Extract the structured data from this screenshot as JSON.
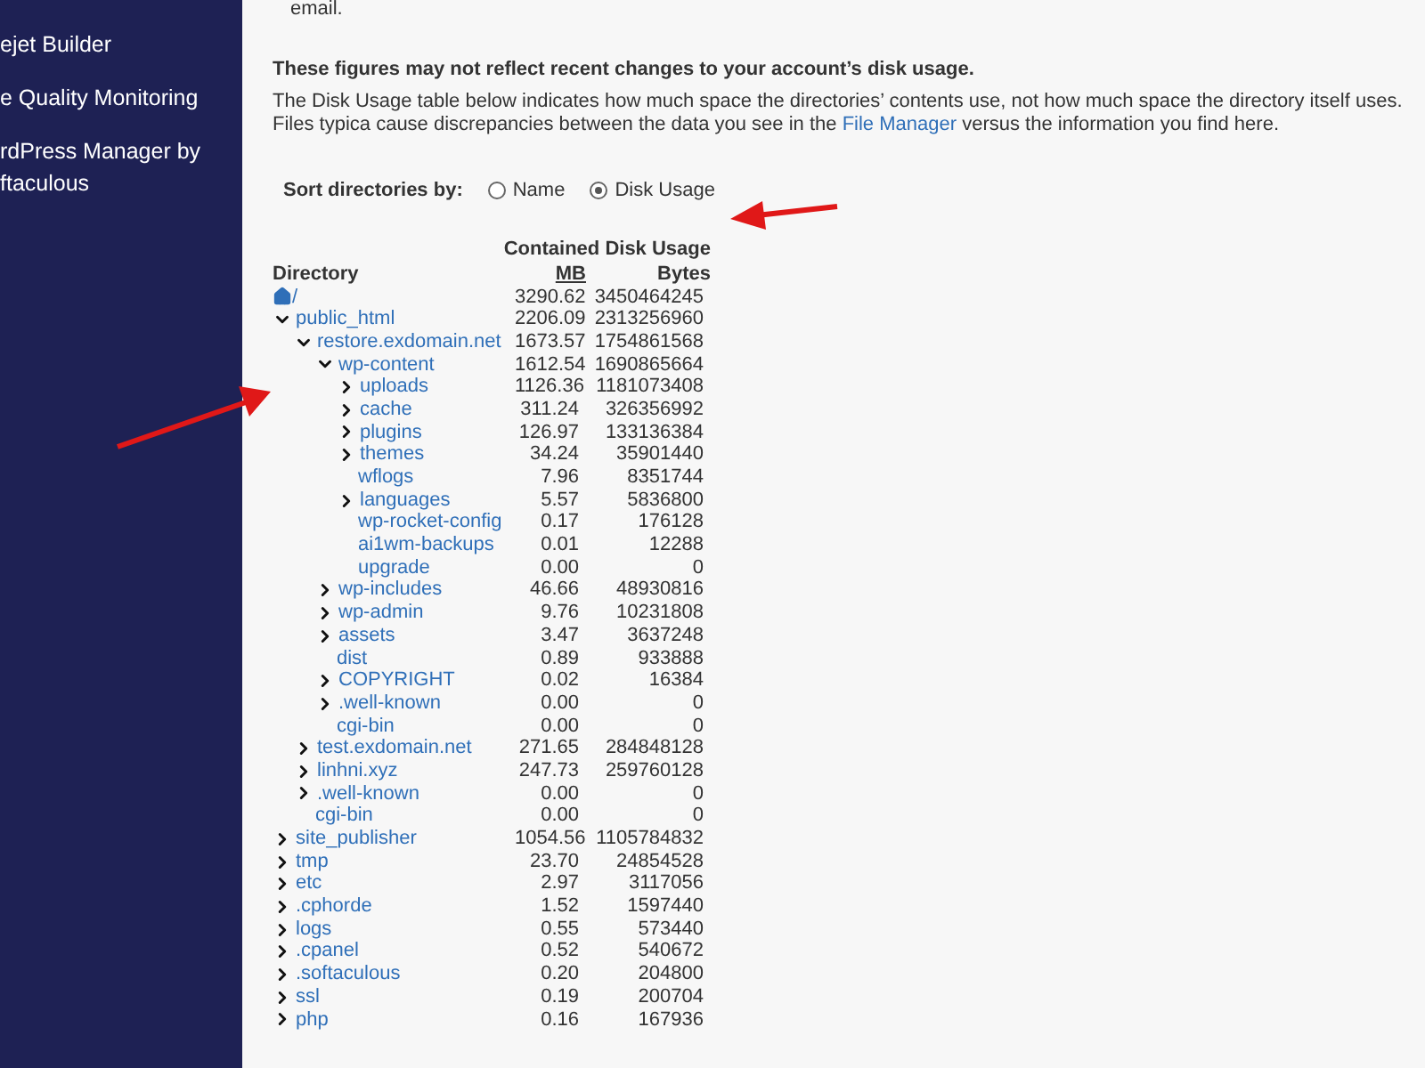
{
  "sidebar": {
    "items": [
      {
        "lines": [
          "ejet Builder"
        ]
      },
      {
        "lines": [
          "e Quality Monitoring"
        ]
      },
      {
        "lines": [
          "rdPress Manager by",
          "ftaculous"
        ]
      }
    ]
  },
  "top_fragment": "email.",
  "notice": {
    "title": "These figures may not reflect recent changes to your account’s disk usage.",
    "text_before": "The Disk Usage table below indicates how much space the directories’ contents use, not how much space the directory itself uses. Files typica cause discrepancies between the data you see in the ",
    "link": "File Manager",
    "text_after": " versus the information you find here."
  },
  "sort": {
    "label": "Sort directories by:",
    "options": [
      {
        "label": "Name",
        "selected": false
      },
      {
        "label": "Disk Usage",
        "selected": true
      }
    ]
  },
  "table": {
    "directory_header": "Directory",
    "group_header": "Contained Disk Usage",
    "mb_header": "MB",
    "bytes_header": "Bytes",
    "rows": [
      {
        "name": "/",
        "kind": "root",
        "mb": "3290.62",
        "bytes": "3450464245"
      },
      {
        "name": "public_html",
        "kind": "branch",
        "expanded": true,
        "mb": "2206.09",
        "bytes": "2313256960",
        "children": [
          {
            "name": "restore.exdomain.net",
            "kind": "branch",
            "expanded": true,
            "mb": "1673.57",
            "bytes": "1754861568",
            "children": [
              {
                "name": "wp-content",
                "kind": "branch",
                "expanded": true,
                "mb": "1612.54",
                "bytes": "1690865664",
                "children": [
                  {
                    "name": "uploads",
                    "kind": "branch",
                    "expanded": false,
                    "mb": "1126.36",
                    "bytes": "1181073408"
                  },
                  {
                    "name": "cache",
                    "kind": "branch",
                    "expanded": false,
                    "mb": "311.24",
                    "bytes": "326356992"
                  },
                  {
                    "name": "plugins",
                    "kind": "branch",
                    "expanded": false,
                    "mb": "126.97",
                    "bytes": "133136384"
                  },
                  {
                    "name": "themes",
                    "kind": "branch",
                    "expanded": false,
                    "mb": "34.24",
                    "bytes": "35901440"
                  },
                  {
                    "name": "wflogs",
                    "kind": "leaf",
                    "mb": "7.96",
                    "bytes": "8351744"
                  },
                  {
                    "name": "languages",
                    "kind": "branch",
                    "expanded": false,
                    "mb": "5.57",
                    "bytes": "5836800"
                  },
                  {
                    "name": "wp-rocket-config",
                    "kind": "leaf",
                    "mb": "0.17",
                    "bytes": "176128"
                  },
                  {
                    "name": "ai1wm-backups",
                    "kind": "leaf",
                    "mb": "0.01",
                    "bytes": "12288"
                  },
                  {
                    "name": "upgrade",
                    "kind": "leaf",
                    "mb": "0.00",
                    "bytes": "0"
                  }
                ]
              },
              {
                "name": "wp-includes",
                "kind": "branch",
                "expanded": false,
                "mb": "46.66",
                "bytes": "48930816"
              },
              {
                "name": "wp-admin",
                "kind": "branch",
                "expanded": false,
                "mb": "9.76",
                "bytes": "10231808"
              },
              {
                "name": "assets",
                "kind": "branch",
                "expanded": false,
                "mb": "3.47",
                "bytes": "3637248"
              },
              {
                "name": "dist",
                "kind": "leaf",
                "mb": "0.89",
                "bytes": "933888"
              },
              {
                "name": "COPYRIGHT",
                "kind": "branch",
                "expanded": false,
                "mb": "0.02",
                "bytes": "16384"
              },
              {
                "name": ".well-known",
                "kind": "branch",
                "expanded": false,
                "mb": "0.00",
                "bytes": "0"
              },
              {
                "name": "cgi-bin",
                "kind": "leaf",
                "mb": "0.00",
                "bytes": "0"
              }
            ]
          },
          {
            "name": "test.exdomain.net",
            "kind": "branch",
            "expanded": false,
            "mb": "271.65",
            "bytes": "284848128"
          },
          {
            "name": "linhni.xyz",
            "kind": "branch",
            "expanded": false,
            "mb": "247.73",
            "bytes": "259760128"
          },
          {
            "name": ".well-known",
            "kind": "branch",
            "expanded": false,
            "mb": "0.00",
            "bytes": "0"
          },
          {
            "name": "cgi-bin",
            "kind": "leaf",
            "mb": "0.00",
            "bytes": "0"
          }
        ]
      },
      {
        "name": "site_publisher",
        "kind": "branch",
        "expanded": false,
        "mb": "1054.56",
        "bytes": "1105784832"
      },
      {
        "name": "tmp",
        "kind": "branch",
        "expanded": false,
        "mb": "23.70",
        "bytes": "24854528"
      },
      {
        "name": "etc",
        "kind": "branch",
        "expanded": false,
        "mb": "2.97",
        "bytes": "3117056"
      },
      {
        "name": ".cphorde",
        "kind": "branch",
        "expanded": false,
        "mb": "1.52",
        "bytes": "1597440"
      },
      {
        "name": "logs",
        "kind": "branch",
        "expanded": false,
        "mb": "0.55",
        "bytes": "573440"
      },
      {
        "name": ".cpanel",
        "kind": "branch",
        "expanded": false,
        "mb": "0.52",
        "bytes": "540672"
      },
      {
        "name": ".softaculous",
        "kind": "branch",
        "expanded": false,
        "mb": "0.20",
        "bytes": "204800"
      },
      {
        "name": "ssl",
        "kind": "branch",
        "expanded": false,
        "mb": "0.19",
        "bytes": "200704"
      },
      {
        "name": "php",
        "kind": "branch",
        "expanded": false,
        "mb": "0.16",
        "bytes": "167936"
      }
    ]
  }
}
